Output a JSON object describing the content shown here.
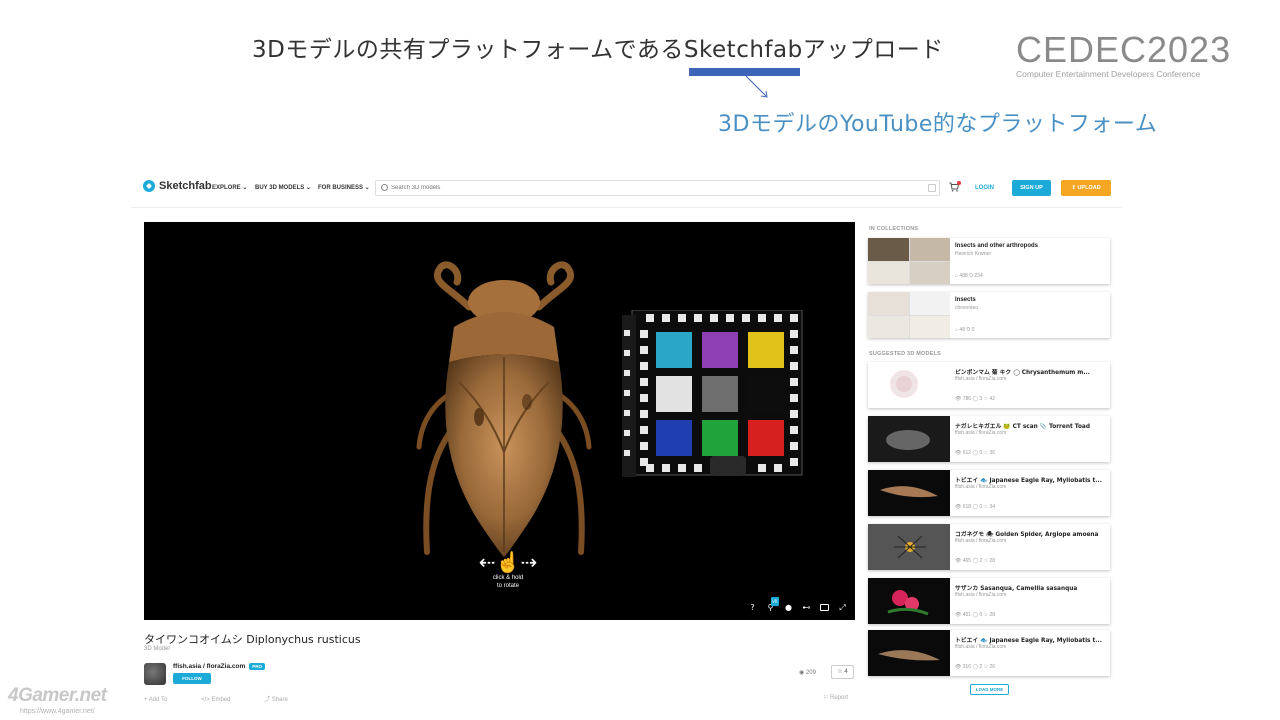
{
  "slide": {
    "title": "3Dモデルの共有プラットフォームであるSketchfabアップロード",
    "subtitle": "3DモデルのYouTube的なプラットフォーム",
    "accent_color": "#3e64b8",
    "subtitle_color": "#4a90c2"
  },
  "cedec": {
    "logo": "CEDEC2023",
    "tagline": "Computer Entertainment Developers Conference"
  },
  "sketchfab": {
    "brand": "Sketchfab",
    "nav": {
      "explore": "EXPLORE ⌄",
      "buy": "BUY 3D MODELS ⌄",
      "business": "FOR BUSINESS ⌄"
    },
    "search": {
      "placeholder": "Search 3D models"
    },
    "login": "LOGIN",
    "signup": "SIGN UP",
    "upload": "UPLOAD",
    "colors": {
      "primary": "#1caad9",
      "upload": "#f5a623"
    }
  },
  "viewer": {
    "hint_line1": "click & hold",
    "hint_line2": "to rotate",
    "controls": [
      "help-icon",
      "vr-icon",
      "settings-icon",
      "gamepad-icon",
      "image-icon",
      "fullscreen-icon"
    ],
    "vr_badge": "VR"
  },
  "model": {
    "title": "タイワンコオイムシ Diplonychus rusticus",
    "type": "3D Model",
    "author": "ffish.asia / floraZia.com",
    "badge": "PRO",
    "follow": "FOLLOW",
    "views": "209",
    "likes": "4",
    "actions": {
      "add_to": "Add To",
      "embed": "Embed",
      "share": "Share",
      "report": "Report"
    }
  },
  "sidebar": {
    "in_collections": "IN COLLECTIONS",
    "collections": [
      {
        "name": "Insects and other arthropods",
        "owner": "Heinrich Kramer",
        "stats": "⌂ 488  ⅁ 234"
      },
      {
        "name": "Insects",
        "owner": "chesonteo",
        "stats": "⌂ 48  ⅁ 0"
      }
    ],
    "suggested_heading": "SUGGESTED 3D MODELS",
    "suggested": [
      {
        "name": "ピンポンマム 菊 キク ◯ Chrysanthemum m...",
        "author": "ffish.asia / floraZia.com",
        "stats": "👁 786  ◯ 3  ☆ 42"
      },
      {
        "name": "ナガレヒキガエル 🐸 CT scan 📎 Torrent Toad",
        "author": "ffish.asia / floraZia.com",
        "stats": "👁 612  ◯ 0  ☆ 36"
      },
      {
        "name": "トビエイ 🐟 Japanese Eagle Ray, Myliobatis t...",
        "author": "ffish.asia / floraZia.com",
        "stats": "👁 618  ◯ 0  ☆ 34"
      },
      {
        "name": "コガネグモ 🕷 Golden Spider, Argiope amoena",
        "author": "ffish.asia / floraZia.com",
        "stats": "👁 465  ◯ 2  ☆ 28"
      },
      {
        "name": "サザンカ Sasanqua, Camellia sasanqua",
        "author": "ffish.asia / floraZia.com",
        "stats": "👁 451  ◯ 0  ☆ 28"
      },
      {
        "name": "トビエイ 🐟 Japanese Eagle Ray, Myliobatis t...",
        "author": "ffish.asia / floraZia.com",
        "stats": "👁 316  ◯ 2  ☆ 26"
      }
    ],
    "load_more": "LOAD MORE"
  },
  "watermark": {
    "brand": "4Gamer.net",
    "url": "https://www.4gamer.net/"
  }
}
